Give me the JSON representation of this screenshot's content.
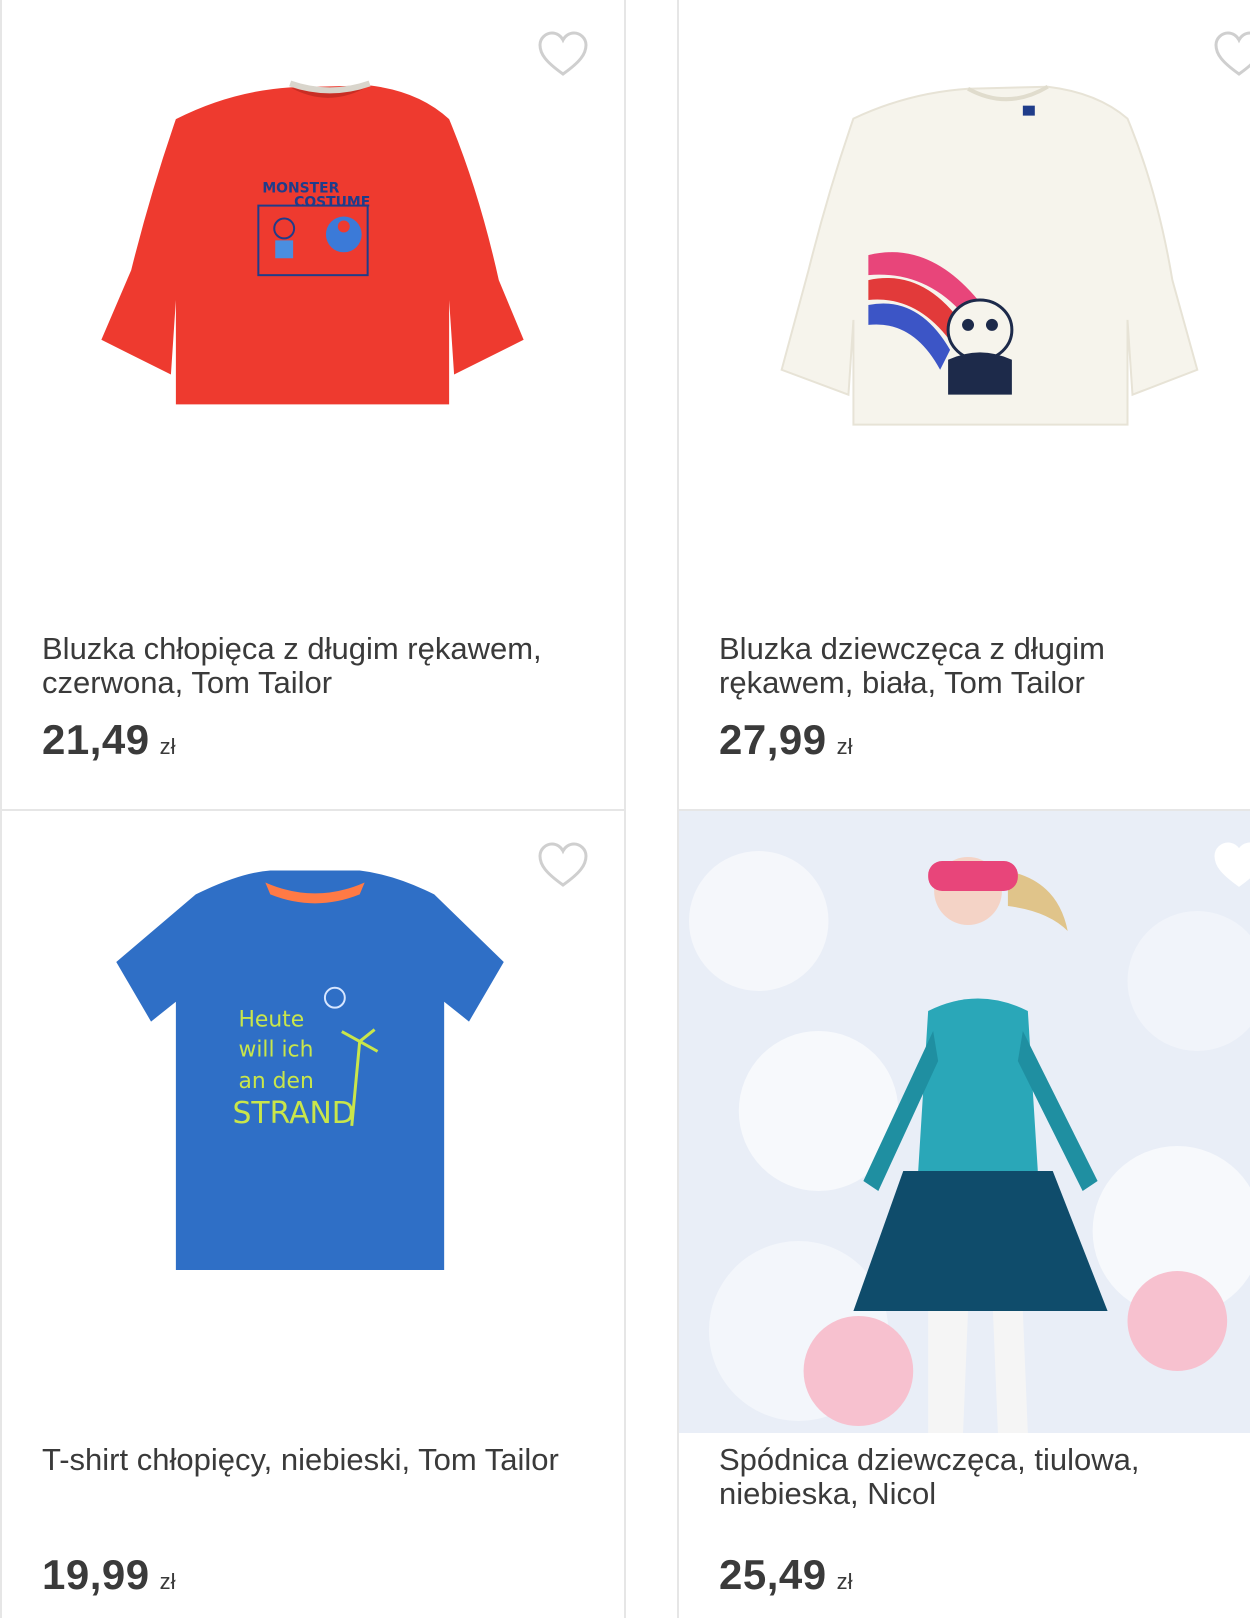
{
  "colors": {
    "text": "#3a3a3a",
    "border": "#e6e6e6",
    "heart_outline": "#cfcfcf"
  },
  "products": [
    {
      "title": "Bluzka chłopięca z długim rękawem, czerwona, Tom Tailor",
      "price": "21,49",
      "currency": "zł",
      "image": {
        "kind": "longsleeve",
        "color": "#ee3a2f",
        "print_text_1": "MONSTER",
        "print_text_2": "COSTUME"
      },
      "favorite_icon": "heart-outline-icon"
    },
    {
      "title": "Bluzka dziewczęca z długim rękawem, biała, Tom Tailor",
      "price": "27,99",
      "currency": "zł",
      "image": {
        "kind": "longsleeve",
        "color": "#f6f4ec",
        "print": "rainbow-panda"
      },
      "favorite_icon": "heart-outline-icon"
    },
    {
      "title": "T-shirt chłopięcy, niebieski, Tom Tailor",
      "price": "19,99",
      "currency": "zł",
      "image": {
        "kind": "tshirt",
        "color": "#2f6fc6",
        "print_lines": [
          "Heute",
          "will ich",
          "an den",
          "STRAND"
        ]
      },
      "favorite_icon": "heart-outline-icon"
    },
    {
      "title": "Spódnica dziewczęca, tiulowa, niebieska, Nicol",
      "price": "25,49",
      "currency": "zł",
      "image": {
        "kind": "photo",
        "description_colors": [
          "#e9eef7",
          "#2aa7b8",
          "#0f4c6b",
          "#e8457a"
        ]
      },
      "favorite_icon": "heart-outline-icon"
    }
  ]
}
